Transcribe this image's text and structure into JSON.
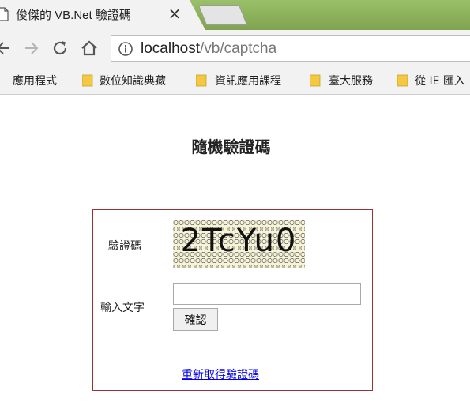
{
  "browser": {
    "tab": {
      "title": "俊傑的 VB.Net 驗證碼",
      "close": "×"
    },
    "url": {
      "host": "localhost",
      "path": "/vb/captcha"
    },
    "bookmarks": [
      {
        "label": "應用程式",
        "icon": "apps-icon"
      },
      {
        "label": "數位知識典藏",
        "icon": "folder-icon"
      },
      {
        "label": "資訊應用課程",
        "icon": "folder-icon"
      },
      {
        "label": "臺大服務",
        "icon": "folder-icon"
      },
      {
        "label": "從 IE 匯入",
        "icon": "folder-icon"
      }
    ],
    "colors": {
      "tabstrip": "#8ab05a",
      "folder": "#f5c842",
      "apps": "#e0552c"
    }
  },
  "page": {
    "title": "隨機驗證碼",
    "captcha_label": "驗證碼",
    "captcha_text": "2TcYu0",
    "input_label": "輸入文字",
    "input_value": "",
    "confirm_label": "確認",
    "refresh_link": "重新取得驗證碼",
    "colors": {
      "panel_border": "#993333",
      "link": "#0000ee",
      "captcha_bg": "#f7f4d6"
    }
  }
}
